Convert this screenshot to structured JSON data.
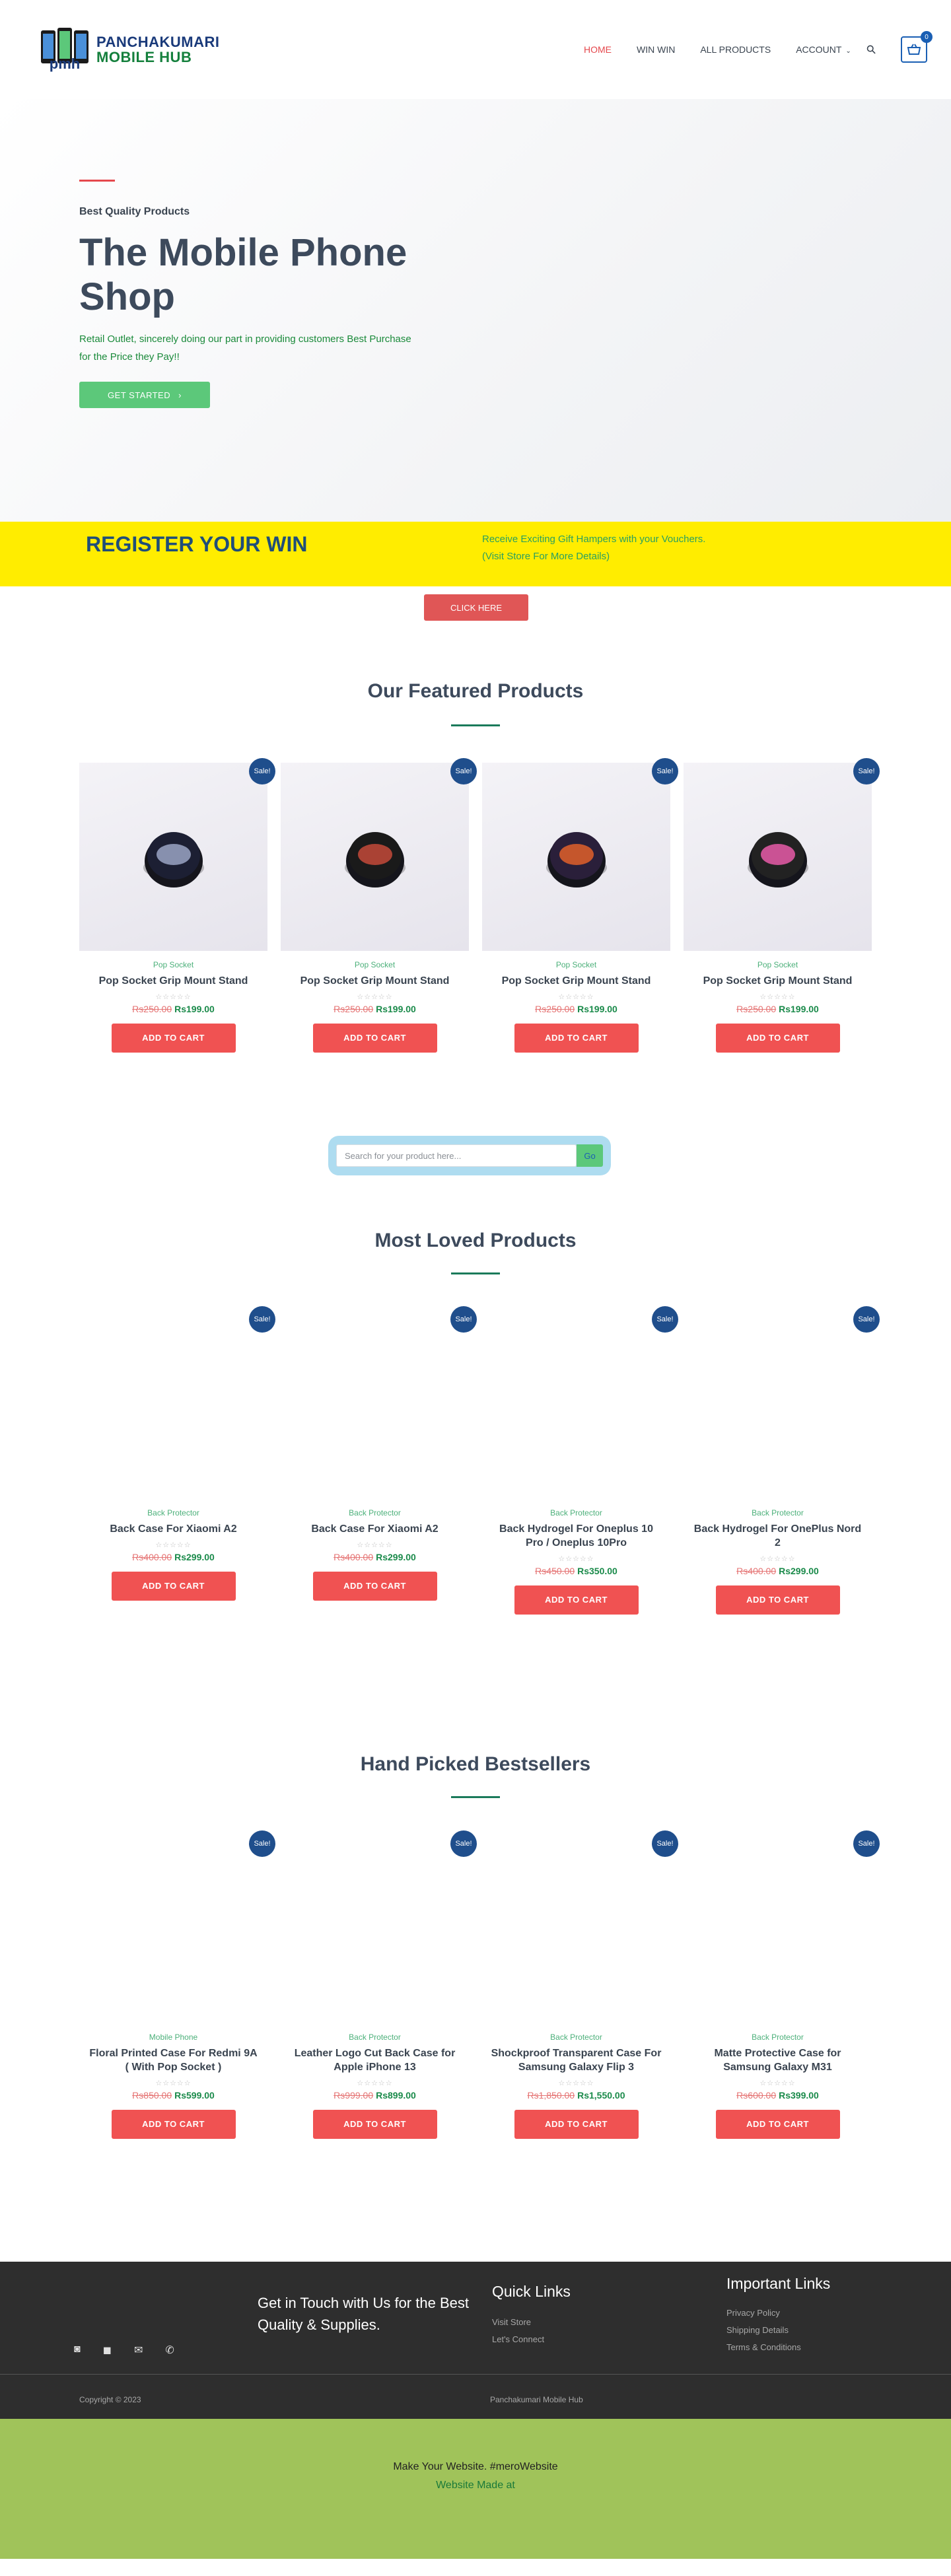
{
  "brand": {
    "line1": "PANCHAKUMARI",
    "line2": "MOBILE HUB",
    "mark": "pmh"
  },
  "nav": {
    "items": [
      "HOME",
      "WIN WIN",
      "ALL PRODUCTS",
      "ACCOUNT"
    ],
    "search_icon": "search-icon",
    "cart_icon": "basket-icon",
    "cart_count": "0"
  },
  "hero": {
    "eyebrow": "Best Quality Products",
    "title": "The Mobile Phone Shop",
    "description": "Retail Outlet, sincerely doing our part in providing customers Best Purchase for the Price they Pay!!",
    "button": "GET STARTED"
  },
  "register": {
    "title": "REGISTER YOUR WIN",
    "note1": "Receive Exciting Gift Hampers with your Vouchers.",
    "note2": "(Visit Store For More Details)",
    "button": "CLICK HERE"
  },
  "sale_label": "Sale!",
  "add_to_cart": "ADD TO CART",
  "rating_stars": "☆☆☆☆☆",
  "featured": {
    "title": "Our Featured Products",
    "products": [
      {
        "category": "Pop Socket",
        "name": "Pop Socket Grip Mount Stand",
        "old": "Rs250.00",
        "new": "Rs199.00"
      },
      {
        "category": "Pop Socket",
        "name": "Pop Socket Grip Mount Stand",
        "old": "Rs250.00",
        "new": "Rs199.00"
      },
      {
        "category": "Pop Socket",
        "name": "Pop Socket Grip Mount Stand",
        "old": "Rs250.00",
        "new": "Rs199.00"
      },
      {
        "category": "Pop Socket",
        "name": "Pop Socket Grip Mount Stand",
        "old": "Rs250.00",
        "new": "Rs199.00"
      }
    ]
  },
  "search": {
    "placeholder": "Search for your product here...",
    "button": "Go"
  },
  "loved": {
    "title": "Most Loved Products",
    "products": [
      {
        "category": "Back Protector",
        "name": "Back Case For Xiaomi A2",
        "old": "Rs400.00",
        "new": "Rs299.00"
      },
      {
        "category": "Back Protector",
        "name": "Back Case For Xiaomi A2",
        "old": "Rs400.00",
        "new": "Rs299.00"
      },
      {
        "category": "Back Protector",
        "name": "Back Hydrogel For Oneplus 10 Pro / Oneplus 10Pro",
        "old": "Rs450.00",
        "new": "Rs350.00"
      },
      {
        "category": "Back Protector",
        "name": "Back Hydrogel For OnePlus Nord 2",
        "old": "Rs400.00",
        "new": "Rs299.00"
      }
    ]
  },
  "bestsellers": {
    "title": "Hand Picked Bestsellers",
    "products": [
      {
        "category": "Mobile Phone",
        "name": "Floral Printed Case For Redmi 9A ( With Pop Socket )",
        "old": "Rs850.00",
        "new": "Rs599.00"
      },
      {
        "category": "Back Protector",
        "name": "Leather Logo Cut Back Case for Apple iPhone 13",
        "old": "Rs999.00",
        "new": "Rs899.00"
      },
      {
        "category": "Back Protector",
        "name": "Shockproof Transparent Case For Samsung Galaxy Flip 3",
        "old": "Rs1,850.00",
        "new": "Rs1,550.00"
      },
      {
        "category": "Back Protector",
        "name": "Matte Protective Case for Samsung Galaxy M31",
        "old": "Rs600.00",
        "new": "Rs399.00"
      }
    ]
  },
  "footer": {
    "touch": "Get in Touch with Us for the Best Quality & Supplies.",
    "icons": [
      "instagram-icon",
      "facebook-icon",
      "mail-icon",
      "phone-icon"
    ],
    "quick_links_title": "Quick Links",
    "quick_links": [
      "Visit Store",
      "Let's Connect"
    ],
    "important_title": "Important Links",
    "important_links": [
      "Privacy Policy",
      "Shipping Details",
      "Terms & Conditions"
    ],
    "copyright": "Copyright © 2023",
    "brand": "Panchakumari Mobile Hub"
  },
  "credit": {
    "line1": "Make Your Website. #meroWebsite",
    "line2": "Website Made at"
  },
  "colors": {
    "accent_red": "#f05252",
    "brand_blue": "#1f4e8c",
    "green": "#5cc87a",
    "band_yellow": "#ffed00",
    "footer_dark": "#2e2e2e",
    "credit_green": "#a0c35a"
  }
}
